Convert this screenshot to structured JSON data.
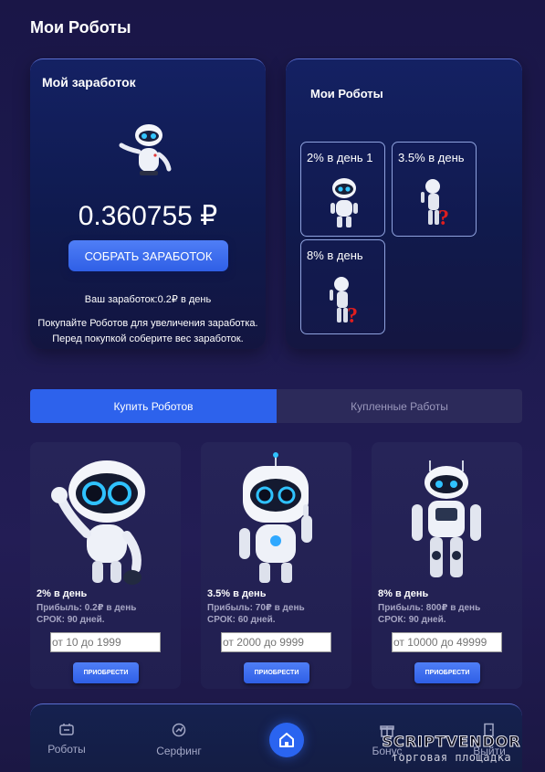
{
  "page": {
    "title": "Мои Роботы"
  },
  "earnings": {
    "title": "Мой заработок",
    "amount": "0.360755 ₽",
    "collect_button": "СОБРАТЬ ЗАРАБОТОК",
    "rate": "Ваш заработок:0.2₽ в день",
    "note_line1": "Покупайте Роботов для увеличения заработка.",
    "note_line2": "Перед покупкой соберите вес заработок."
  },
  "my_robots": {
    "title": "Мои Роботы",
    "items": [
      {
        "label": "2% в день 1"
      },
      {
        "label": "3.5% в день"
      },
      {
        "label": "8% в день"
      }
    ]
  },
  "tabs": [
    {
      "label": "Купить Роботов",
      "active": true
    },
    {
      "label": "Купленные Работы",
      "active": false
    }
  ],
  "products": [
    {
      "name": "2% в день",
      "profit": "Прибыль: 0.2₽ в день",
      "term": "СРОК: 90 дней.",
      "placeholder": "от 10 до 1999",
      "buy": "ПРИОБРЕСТИ"
    },
    {
      "name": "3.5% в день",
      "profit": "Прибыль: 70₽ в день",
      "term": "СРОК: 60 дней.",
      "placeholder": "от 2000 до 9999",
      "buy": "ПРИОБРЕСТИ"
    },
    {
      "name": "8% в день",
      "profit": "Прибыль: 800₽ в день",
      "term": "СРОК: 90 дней.",
      "placeholder": "от 10000 до 49999",
      "buy": "ПРИОБРЕСТИ"
    }
  ],
  "nav": {
    "robots": "Роботы",
    "surfing": "Серфинг",
    "bonus": "Бонус",
    "logout": "Выйти"
  },
  "watermark": {
    "title": "SCRIPTVENDOR",
    "subtitle": "торговая площадка"
  },
  "colors": {
    "accent": "#2d62ec",
    "background": "#1d1a4f",
    "card": "#142163"
  },
  "icons": {
    "robots": "briefcase-icon",
    "surfing": "gauge-icon",
    "home": "home-icon",
    "bonus": "gift-icon",
    "logout": "exit-door-icon"
  }
}
